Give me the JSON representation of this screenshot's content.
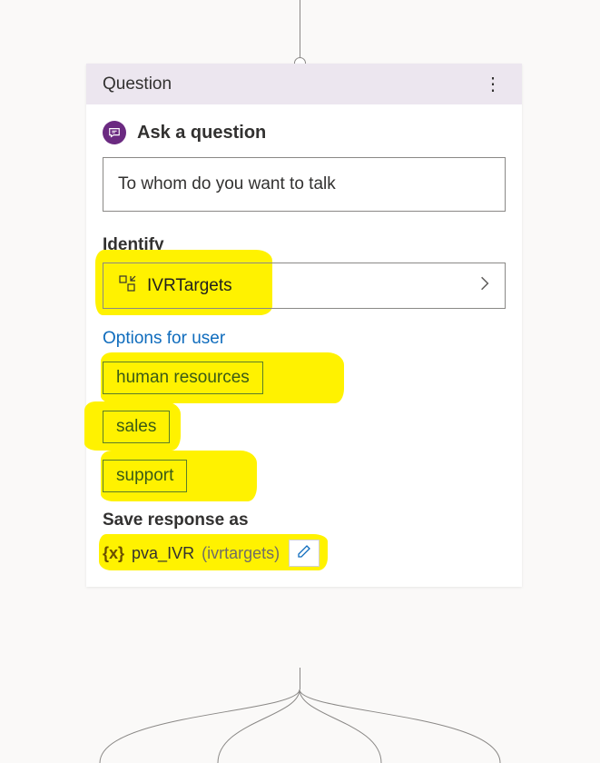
{
  "card": {
    "title": "Question",
    "ask_label": "Ask a question",
    "prompt": "To whom do you want to talk",
    "identify_label": "Identify",
    "identify_value": "IVRTargets",
    "options_link": "Options for user",
    "options": [
      "human resources",
      "sales",
      "support"
    ],
    "save_label": "Save response as",
    "variable_brace": "{x}",
    "variable_name": "pva_IVR",
    "variable_type": "(ivrtargets)"
  }
}
